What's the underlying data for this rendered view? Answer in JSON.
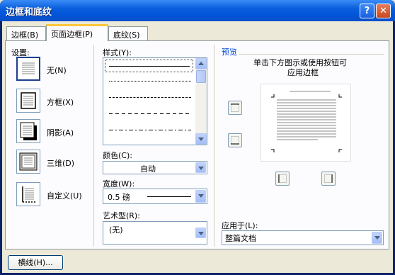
{
  "window": {
    "title": "边框和底纹",
    "help_symbol": "?",
    "close_symbol": "✕"
  },
  "tabs": [
    {
      "label": "边框(B)"
    },
    {
      "label": "页面边框(P)"
    },
    {
      "label": "底纹(S)"
    }
  ],
  "settings": {
    "heading": "设置:",
    "items": [
      {
        "label": "无(N)"
      },
      {
        "label": "方框(X)"
      },
      {
        "label": "阴影(A)"
      },
      {
        "label": "三维(D)"
      },
      {
        "label": "自定义(U)"
      }
    ]
  },
  "style": {
    "label": "样式(Y):",
    "lines": [
      "solid",
      "dotted",
      "dashed",
      "longdash",
      "dashdot"
    ]
  },
  "color": {
    "label": "颜色(C):",
    "value": "自动"
  },
  "width": {
    "label": "宽度(W):",
    "value": "0.5 磅"
  },
  "art": {
    "label": "艺术型(R):",
    "value": "(无)"
  },
  "preview": {
    "heading": "预览",
    "instruction_line1": "单击下方图示或使用按钮可",
    "instruction_line2": "应用边框"
  },
  "apply_to": {
    "label": "应用于(L):",
    "value": "整篇文档"
  },
  "bottom_button": {
    "label": "横线(H)..."
  },
  "colors": {
    "accent": "#0054E3",
    "tab_highlight": "#FFC83C",
    "group_heading": "#0046D5"
  }
}
